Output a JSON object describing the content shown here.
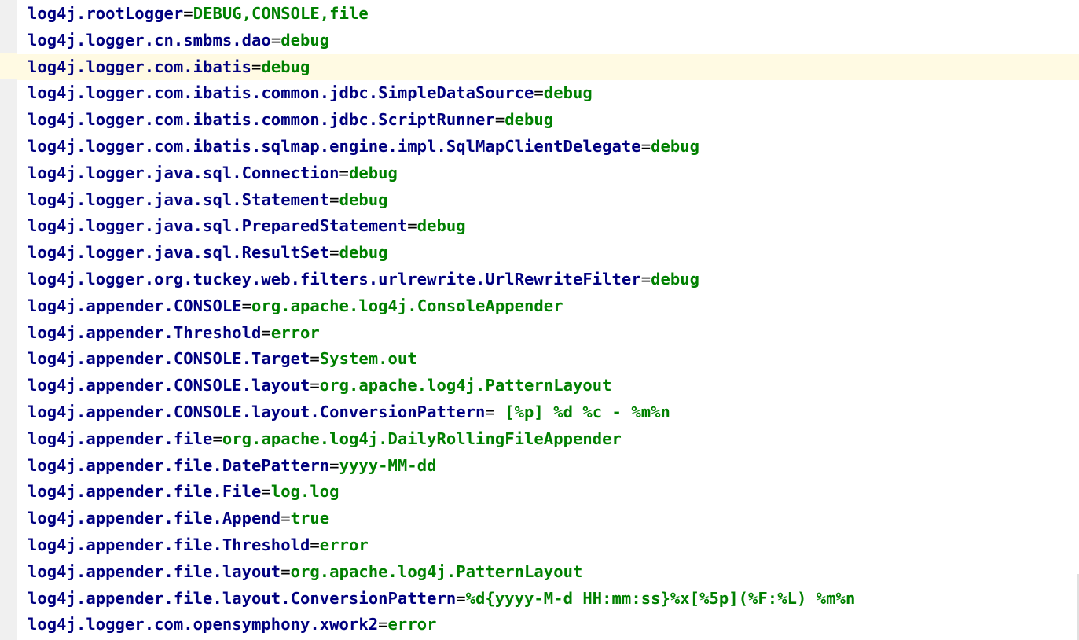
{
  "current_line_index": 2,
  "lines": [
    {
      "key": "log4j.rootLogger",
      "eq": "=",
      "value": "DEBUG,CONSOLE,file"
    },
    {
      "key": "log4j.logger.cn.smbms.dao",
      "eq": "=",
      "value": "debug"
    },
    {
      "key": "log4j.logger.com.ibatis",
      "eq": "=",
      "value": "debug"
    },
    {
      "key": "log4j.logger.com.ibatis.common.jdbc.SimpleDataSource",
      "eq": "=",
      "value": "debug"
    },
    {
      "key": "log4j.logger.com.ibatis.common.jdbc.ScriptRunner",
      "eq": "=",
      "value": "debug"
    },
    {
      "key": "log4j.logger.com.ibatis.sqlmap.engine.impl.SqlMapClientDelegate",
      "eq": "=",
      "value": "debug"
    },
    {
      "key": "log4j.logger.java.sql.Connection",
      "eq": "=",
      "value": "debug"
    },
    {
      "key": "log4j.logger.java.sql.Statement",
      "eq": "=",
      "value": "debug"
    },
    {
      "key": "log4j.logger.java.sql.PreparedStatement",
      "eq": "=",
      "value": "debug"
    },
    {
      "key": "log4j.logger.java.sql.ResultSet",
      "eq": "=",
      "value": "debug"
    },
    {
      "key": "log4j.logger.org.tuckey.web.filters.urlrewrite.UrlRewriteFilter",
      "eq": "=",
      "value": "debug"
    },
    {
      "key": "log4j.appender.CONSOLE",
      "eq": "=",
      "value": "org.apache.log4j.ConsoleAppender"
    },
    {
      "key": "log4j.appender.Threshold",
      "eq": "=",
      "value": "error"
    },
    {
      "key": "log4j.appender.CONSOLE.Target",
      "eq": "=",
      "value": "System.out"
    },
    {
      "key": "log4j.appender.CONSOLE.layout",
      "eq": "=",
      "value": "org.apache.log4j.PatternLayout"
    },
    {
      "key": "log4j.appender.CONSOLE.layout.ConversionPattern",
      "eq": "=",
      "value": " [%p] %d %c - %m%n"
    },
    {
      "key": "log4j.appender.file",
      "eq": "=",
      "value": "org.apache.log4j.DailyRollingFileAppender"
    },
    {
      "key": "log4j.appender.file.DatePattern",
      "eq": "=",
      "value": "yyyy-MM-dd"
    },
    {
      "key": "log4j.appender.file.File",
      "eq": "=",
      "value": "log.log"
    },
    {
      "key": "log4j.appender.file.Append",
      "eq": "=",
      "value": "true"
    },
    {
      "key": "log4j.appender.file.Threshold",
      "eq": "=",
      "value": "error"
    },
    {
      "key": "log4j.appender.file.layout",
      "eq": "=",
      "value": "org.apache.log4j.PatternLayout"
    },
    {
      "key": "log4j.appender.file.layout.ConversionPattern",
      "eq": "=",
      "value": "%d{yyyy-M-d HH:mm:ss}%x[%5p](%F:%L) %m%n"
    },
    {
      "key": "log4j.logger.com.opensymphony.xwork2",
      "eq": "=",
      "value": "error"
    }
  ],
  "colors": {
    "key": "#000080",
    "value": "#008000",
    "current_line": "#fffae3",
    "gutter": "#f0f0f0"
  }
}
